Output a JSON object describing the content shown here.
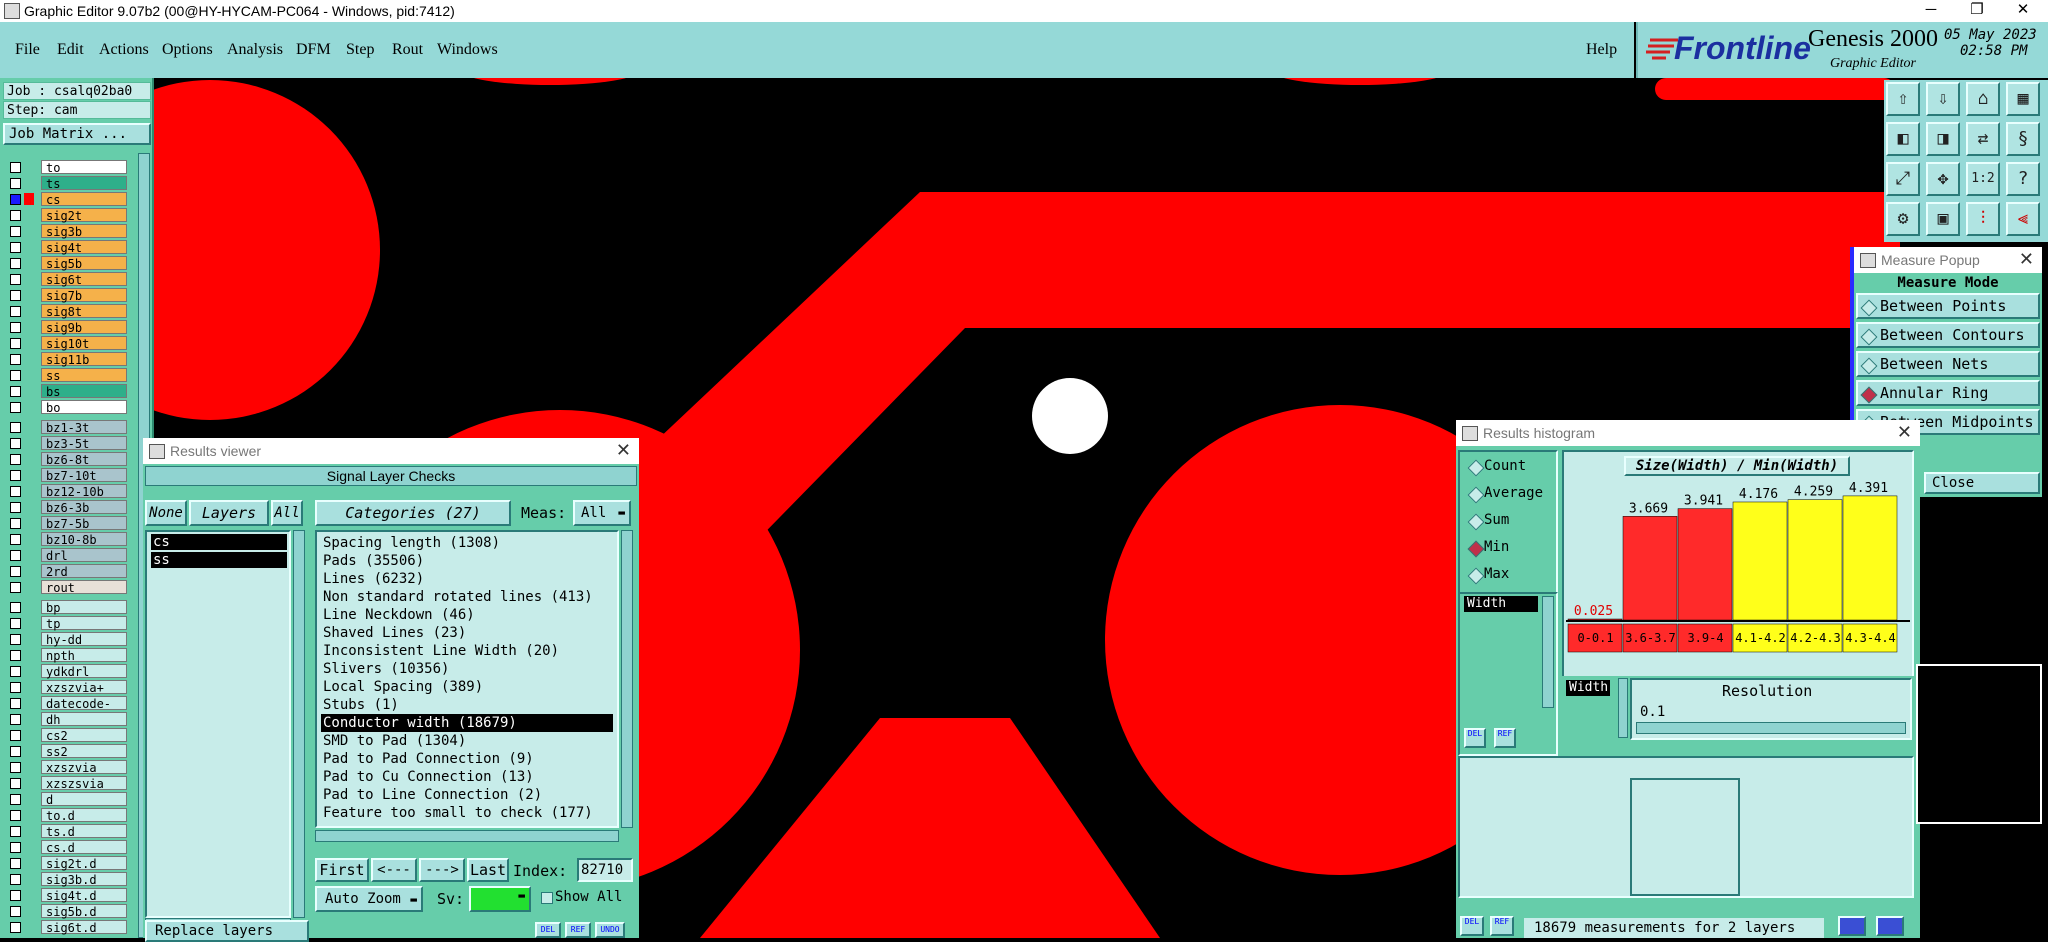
{
  "window": {
    "title": "Graphic Editor 9.07b2 (00@HY-HYCAM-PC064 - Windows, pid:7412)",
    "controls": [
      "─",
      "❐",
      "✕"
    ]
  },
  "menu": {
    "items": [
      "File",
      "Edit",
      "Actions",
      "Options",
      "Analysis",
      "DFM",
      "Step",
      "Rout",
      "Windows"
    ],
    "help": "Help"
  },
  "logo": {
    "brand": "Frontline",
    "product": "Genesis 2000",
    "subtitle": "Graphic Editor",
    "date": "05 May 2023",
    "time": "02:58 PM"
  },
  "job": {
    "job_label": "Job : csalq02ba0",
    "step_label": "Step: cam",
    "matrix_button": "Job Matrix ..."
  },
  "layers": {
    "group1": [
      {
        "name": "to",
        "color": "#ffffff",
        "checked": false
      },
      {
        "name": "ts",
        "color": "#2eaf8a",
        "checked": false
      },
      {
        "name": "cs",
        "color": "#f5b14a",
        "checked": true,
        "swatch": "#ff0000"
      },
      {
        "name": "sig2t",
        "color": "#f5b14a",
        "checked": false
      },
      {
        "name": "sig3b",
        "color": "#f5b14a",
        "checked": false
      },
      {
        "name": "sig4t",
        "color": "#f5b14a",
        "checked": false
      },
      {
        "name": "sig5b",
        "color": "#f5b14a",
        "checked": false
      },
      {
        "name": "sig6t",
        "color": "#f5b14a",
        "checked": false
      },
      {
        "name": "sig7b",
        "color": "#f5b14a",
        "checked": false
      },
      {
        "name": "sig8t",
        "color": "#f5b14a",
        "checked": false
      },
      {
        "name": "sig9b",
        "color": "#f5b14a",
        "checked": false
      },
      {
        "name": "sig10t",
        "color": "#f5b14a",
        "checked": false
      },
      {
        "name": "sig11b",
        "color": "#f5b14a",
        "checked": false
      },
      {
        "name": "ss",
        "color": "#f5b14a",
        "checked": false
      },
      {
        "name": "bs",
        "color": "#2eaf8a",
        "checked": false
      },
      {
        "name": "bo",
        "color": "#ffffff",
        "checked": false
      }
    ],
    "group2": [
      {
        "name": "bz1-3t",
        "color": "#a9c4cc"
      },
      {
        "name": "bz3-5t",
        "color": "#a9c4cc"
      },
      {
        "name": "bz6-8t",
        "color": "#a9c4cc"
      },
      {
        "name": "bz7-10t",
        "color": "#a9c4cc"
      },
      {
        "name": "bz12-10b",
        "color": "#a9c4cc"
      },
      {
        "name": "bz6-3b",
        "color": "#a9c4cc"
      },
      {
        "name": "bz7-5b",
        "color": "#a9c4cc"
      },
      {
        "name": "bz10-8b",
        "color": "#a9c4cc"
      },
      {
        "name": "drl",
        "color": "#a9c4cc"
      },
      {
        "name": "2rd",
        "color": "#a9c4cc"
      },
      {
        "name": "rout",
        "color": "#e8e0d8"
      }
    ],
    "group3": [
      {
        "name": "bp",
        "color": "#c7ece9"
      },
      {
        "name": "tp",
        "color": "#c7ece9"
      },
      {
        "name": "hy-dd",
        "color": "#c7ece9"
      },
      {
        "name": "npth",
        "color": "#c7ece9"
      },
      {
        "name": "ydkdrl",
        "color": "#c7ece9"
      },
      {
        "name": "xzszvia+",
        "color": "#c7ece9"
      },
      {
        "name": "datecode-pbe",
        "color": "#c7ece9"
      },
      {
        "name": "dh",
        "color": "#c7ece9"
      },
      {
        "name": "cs2",
        "color": "#c7ece9"
      },
      {
        "name": "ss2",
        "color": "#c7ece9"
      },
      {
        "name": "xzszvia",
        "color": "#c7ece9"
      },
      {
        "name": "xzszsvia",
        "color": "#c7ece9"
      },
      {
        "name": "d",
        "color": "#c7ece9"
      },
      {
        "name": "to.d",
        "color": "#c7ece9"
      },
      {
        "name": "ts.d",
        "color": "#c7ece9"
      },
      {
        "name": "cs.d",
        "color": "#c7ece9"
      },
      {
        "name": "sig2t.d",
        "color": "#c7ece9"
      },
      {
        "name": "sig3b.d",
        "color": "#c7ece9"
      },
      {
        "name": "sig4t.d",
        "color": "#c7ece9"
      },
      {
        "name": "sig5b.d",
        "color": "#c7ece9"
      },
      {
        "name": "sig6t.d",
        "color": "#c7ece9"
      }
    ]
  },
  "results_viewer": {
    "title": "Results viewer",
    "header": "Signal Layer Checks",
    "none_btn": "None",
    "layers_btn": "Layers",
    "all_btn": "All",
    "categories_btn": "Categories (27)",
    "meas_label": "Meas:",
    "meas_value": "All",
    "layer_list": [
      "cs",
      "ss"
    ],
    "categories": [
      "Spacing length (1308)",
      "Pads (35506)",
      "Lines (6232)",
      "Non standard rotated lines (413)",
      "Line Neckdown (46)",
      "Shaved Lines (23)",
      "Inconsistent Line Width (20)",
      "Slivers (10356)",
      "Local Spacing (389)",
      "Stubs (1)",
      "Conductor width (18679)",
      "SMD to Pad (1304)",
      "Pad to Pad Connection (9)",
      "Pad to Cu Connection (13)",
      "Pad to Line Connection (2)",
      "Feature too small to check (177)"
    ],
    "selected_index": 10,
    "nav": {
      "first": "First",
      "prev": "<---",
      "next": "--->",
      "last": "Last",
      "index_label": "Index:",
      "index_value": "82710"
    },
    "auto_zoom": "Auto Zoom",
    "sv_label": "Sv:",
    "show_all": "Show All",
    "replace_layers": "Replace layers",
    "bottom_icons": [
      "DEL",
      "REF",
      "UNDO"
    ]
  },
  "measure_popup": {
    "title": "Measure Popup",
    "mode_label": "Measure Mode",
    "options": [
      "Between Points",
      "Between Contours",
      "Between Nets",
      "Annular Ring",
      "Between Midpoints"
    ],
    "selected": "Annular Ring",
    "close": "Close"
  },
  "histogram": {
    "title": "Results histogram",
    "options": [
      "Count",
      "Average",
      "Sum",
      "Min",
      "Max"
    ],
    "selected": "Min",
    "attribute": "Width",
    "chart_title": "Size(Width) / Min(Width)",
    "resolution_label": "Resolution",
    "resolution_value": "0.1",
    "res_attribute": "Width",
    "status": "18679 measurements for 2 layers",
    "icons": [
      "DEL",
      "REF"
    ]
  },
  "chart_data": {
    "type": "bar",
    "title": "Size(Width) / Min(Width)",
    "categories": [
      "0-0.1",
      "3.6-3.7",
      "3.9-4",
      "4.1-4.2",
      "4.2-4.3",
      "4.3-4.4"
    ],
    "values": [
      0.025,
      3.669,
      3.941,
      4.176,
      4.259,
      4.391
    ],
    "value_labels": [
      "0.025",
      "3.669",
      "3.941",
      "4.176",
      "4.259",
      "4.391"
    ],
    "bar_colors": [
      "#ff2a2a",
      "#ff2a2a",
      "#ff2a2a",
      "#ffff1a",
      "#ffff1a",
      "#ffff1a"
    ],
    "ylim": [
      0,
      4.6
    ]
  }
}
